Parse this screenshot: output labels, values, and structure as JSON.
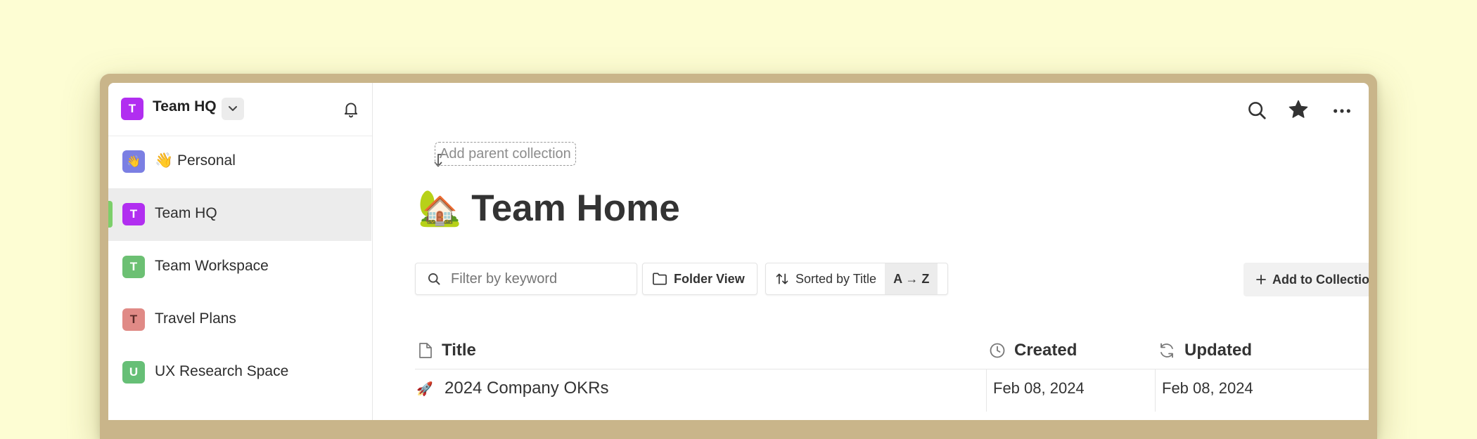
{
  "workspace": {
    "name": "Team HQ",
    "initial": "T",
    "color": "#b12ef0"
  },
  "sidebar": {
    "items": [
      {
        "label": "👋 Personal",
        "initial": "👋",
        "color": "#7b7fe3",
        "active": false
      },
      {
        "label": "Team HQ",
        "initial": "T",
        "color": "#b12ef0",
        "active": true
      },
      {
        "label": "Team Workspace",
        "initial": "T",
        "color": "#6cc073",
        "active": false
      },
      {
        "label": "Travel Plans",
        "initial": "T",
        "color": "#e08a86",
        "active": false
      },
      {
        "label": "UX Research Space",
        "initial": "U",
        "color": "#66bf76",
        "active": false
      }
    ]
  },
  "header_icons": [
    "search-icon",
    "star-icon",
    "more-icon"
  ],
  "page": {
    "parent_link": "Add parent collection",
    "emoji": "🏡",
    "title": "Team Home"
  },
  "toolbar": {
    "filter_placeholder": "Filter by keyword",
    "folder_view": "Folder View",
    "sorted_by": "Sorted by",
    "sort_field": "Title",
    "sort_order": "A → Z",
    "add_to_collection": "Add to Collection"
  },
  "table": {
    "columns": [
      "Title",
      "Created",
      "Updated"
    ],
    "rows": [
      {
        "icon": "🚀",
        "title": "2024 Company OKRs",
        "created": "Feb 08, 2024",
        "updated": "Feb 08, 2024"
      }
    ]
  }
}
